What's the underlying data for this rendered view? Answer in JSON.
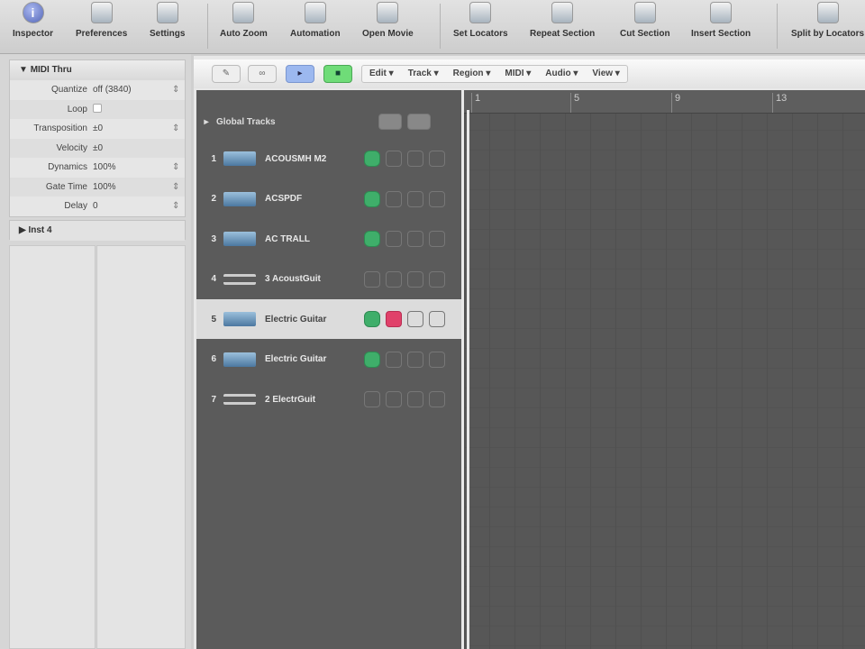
{
  "toolbar": {
    "items": [
      {
        "label": "Inspector",
        "icon": "info-icon"
      },
      {
        "label": "Preferences",
        "icon": "preferences-icon"
      },
      {
        "label": "Settings",
        "icon": "settings-icon"
      },
      {
        "label": "Auto Zoom",
        "icon": "auto-zoom-icon"
      },
      {
        "label": "Automation",
        "icon": "automation-icon"
      },
      {
        "label": "Open Movie",
        "icon": "movie-icon"
      },
      {
        "label": "Set Locators",
        "icon": "locators-icon"
      },
      {
        "label": "Repeat Section",
        "icon": "repeat-icon"
      },
      {
        "label": "Cut Section",
        "icon": "cut-icon"
      },
      {
        "label": "Insert Section",
        "icon": "insert-icon"
      },
      {
        "label": "Split by Locators",
        "icon": "split-icon"
      }
    ]
  },
  "inspector": {
    "midi_thru": "MIDI Thru",
    "params": [
      {
        "label": "Quantize",
        "value": "off (3840)"
      },
      {
        "label": "Loop",
        "value": ""
      },
      {
        "label": "Transposition",
        "value": "±0"
      },
      {
        "label": "Velocity",
        "value": "±0"
      },
      {
        "label": "Dynamics",
        "value": "100%"
      },
      {
        "label": "Gate Time",
        "value": "100%"
      },
      {
        "label": "Delay",
        "value": "0"
      }
    ],
    "inst": "Inst 4"
  },
  "arrange": {
    "menus": [
      "Edit",
      "Track",
      "Region",
      "MIDI",
      "Audio",
      "View"
    ],
    "global_tracks": "Global Tracks",
    "tracks": [
      {
        "num": "1",
        "name": "ACOUSMH M2",
        "type": "midi"
      },
      {
        "num": "2",
        "name": "ACSPDF",
        "type": "midi"
      },
      {
        "num": "3",
        "name": "AC TRALL",
        "type": "midi"
      },
      {
        "num": "4",
        "name": "3 AcoustGuit",
        "type": "audio"
      },
      {
        "num": "5",
        "name": "Electric Guitar",
        "type": "midi",
        "selected": true
      },
      {
        "num": "6",
        "name": "Electric Guitar",
        "type": "midi"
      },
      {
        "num": "7",
        "name": "2 ElectrGuit",
        "type": "audio"
      }
    ],
    "ruler": [
      "1",
      "5",
      "9",
      "13"
    ]
  }
}
